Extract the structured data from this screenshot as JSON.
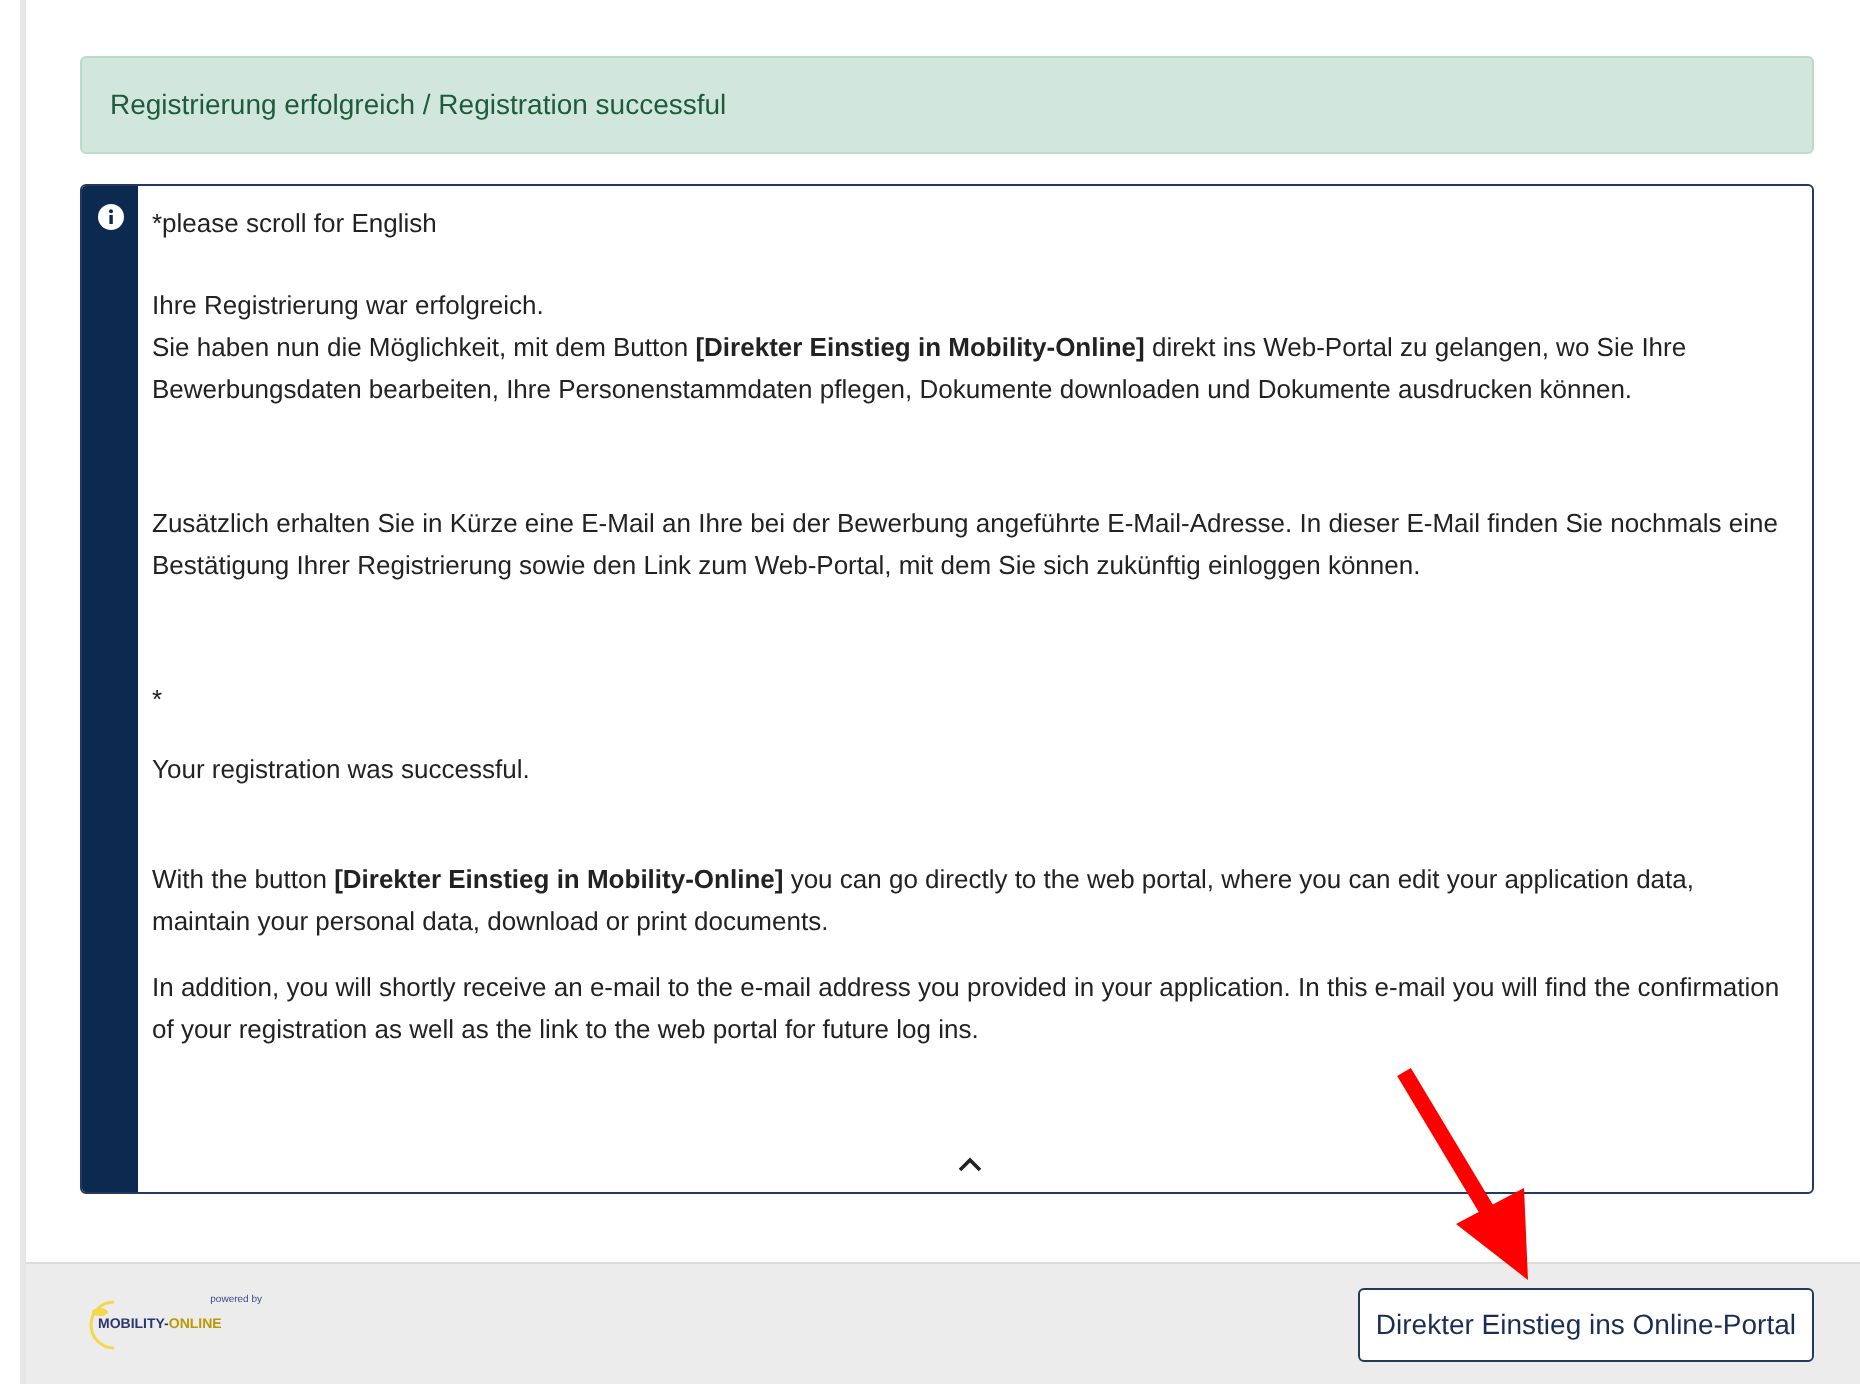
{
  "alert": {
    "text": "Registrierung erfolgreich / Registration successful"
  },
  "info": {
    "paragraphs": [
      "*please scroll for English",
      "Ihre Registrierung war erfolgreich.\nSie haben nun die Möglichkeit, mit dem Button **[Direkter Einstieg in Mobility-Online]** direkt ins Web-Portal zu gelangen, wo Sie Ihre Bewerbungsdaten bearbeiten, Ihre Personenstammdaten pflegen, Dokumente downloaden und Dokumente ausdrucken können.",
      "Zusätzlich erhalten Sie in Kürze eine E-Mail an Ihre bei der Bewerbung angeführte E-Mail-Adresse. In dieser E-Mail finden Sie nochmals eine Bestätigung Ihrer Registrierung sowie den Link zum Web-Portal, mit dem Sie sich zukünftig einloggen können.",
      "*",
      "Your registration was successful.",
      "With the button  **[Direkter Einstieg in Mobility-Online]** you can go directly to the web portal, where you can edit your application data, maintain your personal data, download or print documents.",
      "In addition, you will shortly receive an e-mail to the e-mail address you provided in your application. In this e-mail you will find the confirmation of your registration as well as the link to the web portal for future log ins."
    ]
  },
  "footer": {
    "logo": {
      "tagline": "powered by",
      "name_left": "MOBILITY-",
      "name_right": "ONLINE"
    },
    "button": "Direkter Einstieg ins Online-Portal"
  }
}
